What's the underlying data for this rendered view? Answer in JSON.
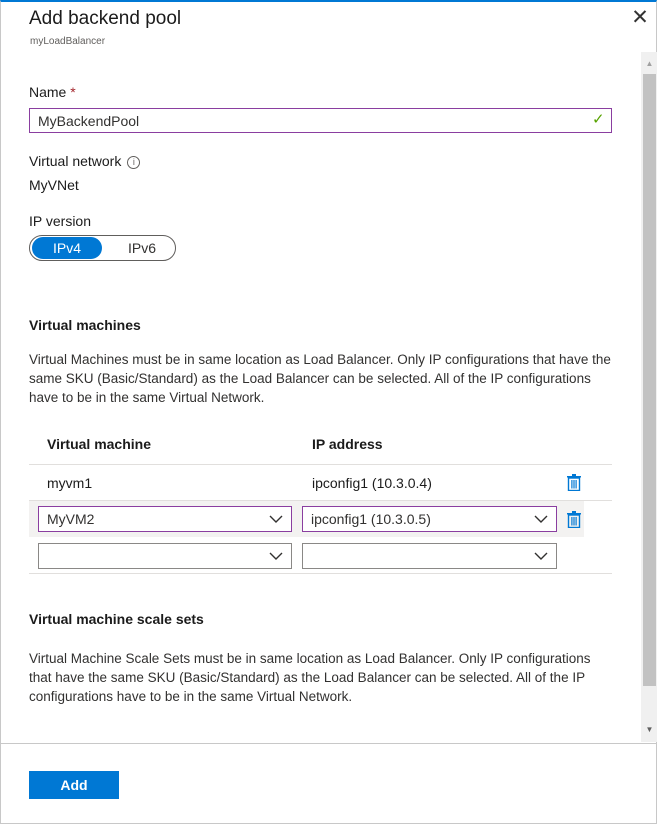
{
  "panel": {
    "title": "Add backend pool",
    "subtitle": "myLoadBalancer",
    "close_glyph": "✕"
  },
  "name_field": {
    "label": "Name",
    "required_mark": "*",
    "value": "MyBackendPool",
    "valid_glyph": "✓"
  },
  "virtual_network": {
    "label": "Virtual network",
    "info_glyph": "i",
    "value": "MyVNet"
  },
  "ip_version": {
    "label": "IP version",
    "options": [
      "IPv4",
      "IPv6"
    ],
    "selected": "IPv4"
  },
  "virtual_machines": {
    "title": "Virtual machines",
    "description": "Virtual Machines must be in same location as Load Balancer. Only IP configurations that have the same SKU (Basic/Standard) as the Load Balancer can be selected. All of the IP configurations have to be in the same Virtual Network.",
    "columns": [
      "Virtual machine",
      "IP address"
    ],
    "rows": [
      {
        "vm": "myvm1",
        "ip": "ipconfig1 (10.3.0.4)"
      },
      {
        "vm": "MyVM2",
        "ip": "ipconfig1 (10.3.0.5)"
      },
      {
        "vm": "",
        "ip": ""
      }
    ]
  },
  "scale_sets": {
    "title": "Virtual machine scale sets",
    "description": "Virtual Machine Scale Sets must be in same location as Load Balancer. Only IP configurations that have the same SKU (Basic/Standard) as the Load Balancer can be selected. All of the IP configurations have to be in the same Virtual Network."
  },
  "footer": {
    "add_label": "Add"
  },
  "colors": {
    "accent": "#0078d4",
    "focus_border": "#8a3ea0",
    "valid": "#57a300",
    "required": "#a4262c"
  },
  "icons": [
    "close-icon",
    "checkmark-icon",
    "info-icon",
    "trash-icon",
    "chevron-down-icon",
    "scroll-up-arrow-icon",
    "scroll-down-arrow-icon"
  ]
}
